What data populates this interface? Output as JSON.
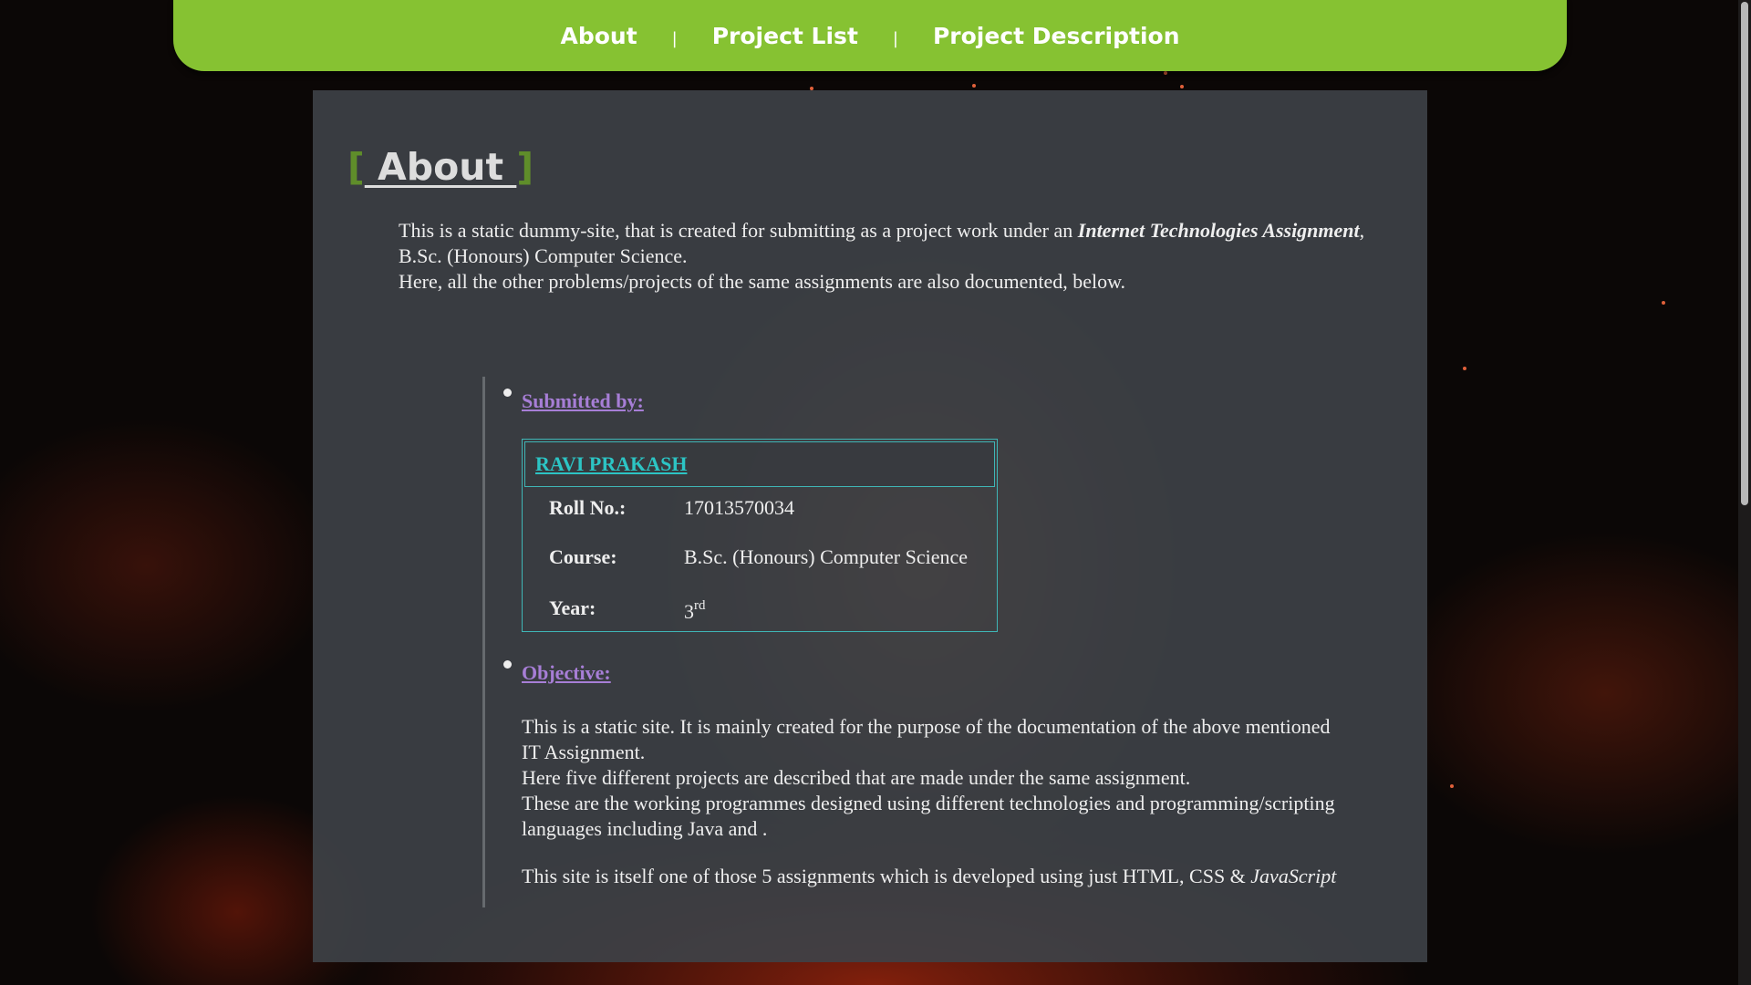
{
  "nav": {
    "items": [
      {
        "label": "About"
      },
      {
        "label": "Project List"
      },
      {
        "label": "Project Description"
      }
    ],
    "separator": "|"
  },
  "section": {
    "bracket_open": "[",
    "title": " About ",
    "bracket_close": "]"
  },
  "intro": {
    "part1": "This is a static dummy-site, that is created for submitting as a project work under an ",
    "emphasis": "Internet Technologies Assignment",
    "part2": ", B.Sc. (Honours) Computer Science.",
    "line2": "Here, all the other problems/projects of the same assignments are also documented, below."
  },
  "submitted": {
    "heading": "Submitted by:",
    "name": "RAVI PRAKASH",
    "roll_label": "Roll No.:",
    "roll_value": "17013570034",
    "course_label": "Course:",
    "course_value": "B.Sc. (Honours) Computer Science",
    "year_label": "Year:",
    "year_value": "3",
    "year_suffix": "rd"
  },
  "objective": {
    "heading": "Objective:",
    "line1": "This is a static site. It is mainly created for the purpose of the documentation of the above mentioned IT Assignment.",
    "line2": "Here five different projects are described that are made under the same assignment.",
    "line3": "These are the working programmes designed using different technologies and programming/scripting languages including Java and .",
    "line4a": "This site is itself one of those 5 assignments which is developed using just HTML, CSS & ",
    "line4b": "JavaScript"
  },
  "colors": {
    "navbar": "#86c232",
    "bracket": "#5f8d2a",
    "heading_link": "#a77ed6",
    "card_border": "#3fb6b6",
    "name_link": "#2cc4c4"
  },
  "icons": {
    "bullet": "bullet-dot-icon"
  }
}
